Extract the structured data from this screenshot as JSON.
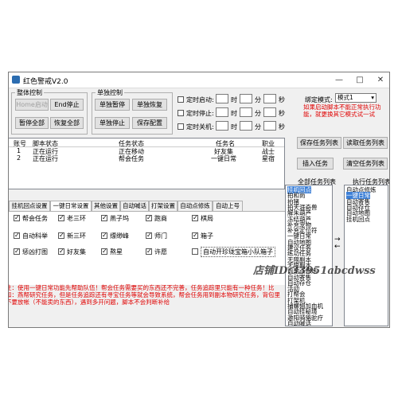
{
  "window": {
    "title": "红色警戒V2.0",
    "minimize": "—",
    "maximize": "□",
    "close": "✕"
  },
  "overall": {
    "legend": "整体控制",
    "home_start": "Home启动",
    "end_stop": "End停止",
    "pause_all": "暂停全部",
    "resume_all": "恢复全部"
  },
  "single": {
    "legend": "单独控制",
    "pause": "单独暂停",
    "resume": "单独恢复",
    "stop": "单独停止",
    "save_config": "保存配置"
  },
  "timers": [
    {
      "label": "定时启动:",
      "checked": false
    },
    {
      "label": "定时停止:",
      "checked": false
    },
    {
      "label": "定时关机:",
      "checked": false
    }
  ],
  "time_units": {
    "hour": "时",
    "minute": "分",
    "second": "秒"
  },
  "bind": {
    "label": "绑定模式:",
    "value": "模式1"
  },
  "warning": "如果启动脚本不能正常执行功能，就更换其它模式试一试",
  "buttons": {
    "save_tasklist": "保存任务列表",
    "read_tasklist": "读取任务列表",
    "insert_task": "插入任务",
    "clear_tasklist": "清空任务列表"
  },
  "table": {
    "columns": [
      "账号",
      "脚本状态",
      "任务状态",
      "任务名",
      "职业"
    ],
    "rows": [
      [
        "1",
        "正在运行",
        "正在移动",
        "好友集",
        "战士"
      ],
      [
        "2",
        "正在运行",
        "帮会任务",
        "一键日常",
        "星宿"
      ]
    ]
  },
  "tabs": [
    "挂机回点设置",
    "一键日常设置",
    "其他设置",
    "自动喊话",
    "打架设置",
    "自动点修炼",
    "自动上号"
  ],
  "daily_options": [
    {
      "label": "帮会任务",
      "checked": true
    },
    {
      "label": "老三环",
      "checked": true
    },
    {
      "label": "燕子坞",
      "checked": true
    },
    {
      "label": "跑商",
      "checked": true
    },
    {
      "label": "棋局",
      "checked": true
    },
    {
      "label": "自动科举",
      "checked": true
    },
    {
      "label": "新三环",
      "checked": true
    },
    {
      "label": "缥缈峰",
      "checked": true
    },
    {
      "label": "师门",
      "checked": true
    },
    {
      "label": "箱子",
      "checked": true
    },
    {
      "label": "惩凶打图",
      "checked": true
    },
    {
      "label": "好友集",
      "checked": true
    },
    {
      "label": "熬星",
      "checked": true
    },
    {
      "label": "许愿",
      "checked": true
    },
    {
      "label": "自动开珍珑宝箱小队箱子",
      "checked": false
    }
  ],
  "note": "注：使用一键日常功能先帮助队伍！帮会任务需要买的东西还不完善，任务追踪里只能有一种任务！比如：燕帮研究任务，但是任务追踪还有寻宝任务等就会导致系统，帮会任务用到副本物研究任务，背包里不要放帐（不能卖的东西），遇到多开问题，脚本不会判断补给",
  "all_tasks": {
    "header": "全部任务列表",
    "items": [
      "挂机回点",
      "拍和尚",
      "拍猪",
      "拍天涯奇兽",
      "解朱葫芦",
      "冻结葫芦",
      "补充宠物",
      "补充定位符",
      "一键日常",
      "自动地图",
      "建议任务",
      "练功任务",
      "无限副本",
      "无限副本",
      "自动点修炼",
      "自动寄售",
      "自动存仓",
      "活动",
      "打帮会",
      "打架机",
      "捕螺翅加血机",
      "自动挂秘境",
      "邀阳骑骆驼疗",
      "自动喊话"
    ]
  },
  "exec_tasks": {
    "header": "执行任务列表",
    "items": [
      "自动点修炼",
      "一键日常",
      "自动寄售",
      "自动存仓",
      "自动地图",
      "挂机回点"
    ]
  },
  "arrows": {
    "right": "→",
    "left": "←"
  },
  "watermark": "店铺ID:33951abcdwss"
}
